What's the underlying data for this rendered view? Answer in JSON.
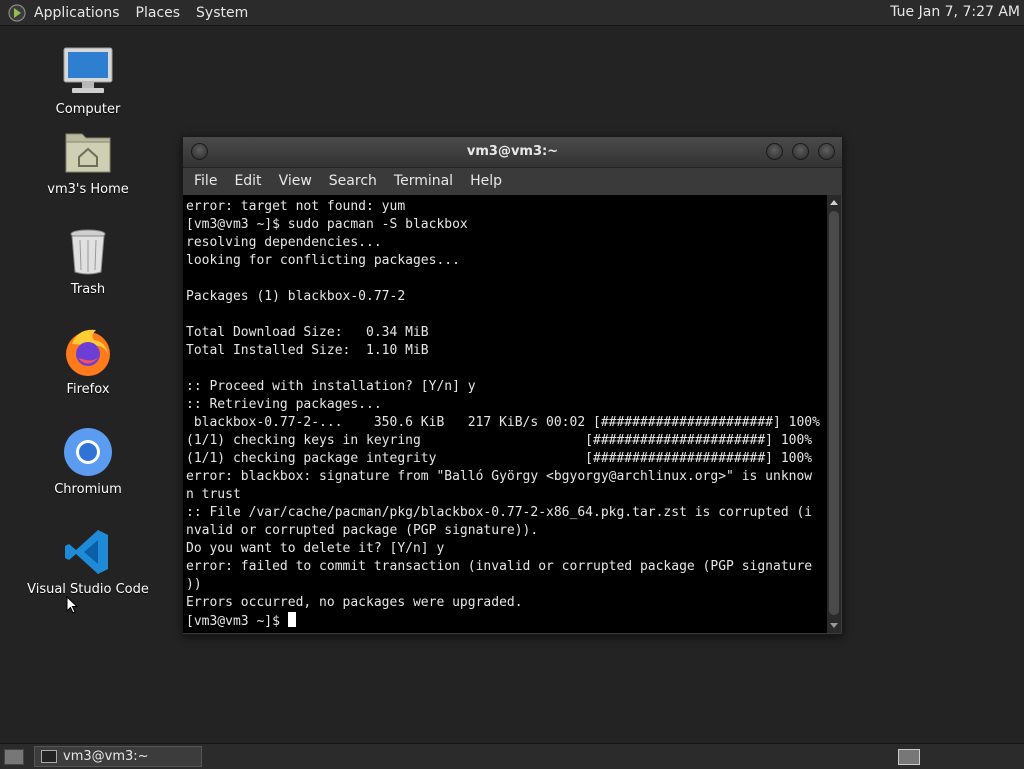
{
  "top_panel": {
    "menus": [
      "Applications",
      "Places",
      "System"
    ],
    "clock": "Tue Jan  7, 7:27 AM"
  },
  "desktop": {
    "icons": [
      {
        "label": "Computer",
        "icon": "computer-icon"
      },
      {
        "label": "vm3's Home",
        "icon": "home-folder-icon"
      },
      {
        "label": "Trash",
        "icon": "trash-icon"
      },
      {
        "label": "Firefox",
        "icon": "firefox-icon"
      },
      {
        "label": "Chromium",
        "icon": "chromium-icon"
      },
      {
        "label": "Visual Studio Code",
        "icon": "vscode-icon"
      }
    ]
  },
  "window": {
    "title": "vm3@vm3:~",
    "menu": [
      "File",
      "Edit",
      "View",
      "Search",
      "Terminal",
      "Help"
    ],
    "terminal_lines": [
      "error: target not found: yum",
      "[vm3@vm3 ~]$ sudo pacman -S blackbox",
      "resolving dependencies...",
      "looking for conflicting packages...",
      "",
      "Packages (1) blackbox-0.77-2",
      "",
      "Total Download Size:   0.34 MiB",
      "Total Installed Size:  1.10 MiB",
      "",
      ":: Proceed with installation? [Y/n] y",
      ":: Retrieving packages...",
      " blackbox-0.77-2-...    350.6 KiB   217 KiB/s 00:02 [######################] 100%",
      "(1/1) checking keys in keyring                     [######################] 100%",
      "(1/1) checking package integrity                   [######################] 100%",
      "error: blackbox: signature from \"Balló György <bgyorgy@archlinux.org>\" is unknow",
      "n trust",
      ":: File /var/cache/pacman/pkg/blackbox-0.77-2-x86_64.pkg.tar.zst is corrupted (i",
      "nvalid or corrupted package (PGP signature)).",
      "Do you want to delete it? [Y/n] y",
      "error: failed to commit transaction (invalid or corrupted package (PGP signature",
      "))",
      "Errors occurred, no packages were upgraded."
    ],
    "prompt": "[vm3@vm3 ~]$ "
  },
  "taskbar": {
    "task_label": "vm3@vm3:~"
  },
  "colors": {
    "desktop_bg": "#232323",
    "panel_bg": "#2b2b2b",
    "terminal_bg": "#000000",
    "terminal_fg": "#e6e6e6"
  }
}
